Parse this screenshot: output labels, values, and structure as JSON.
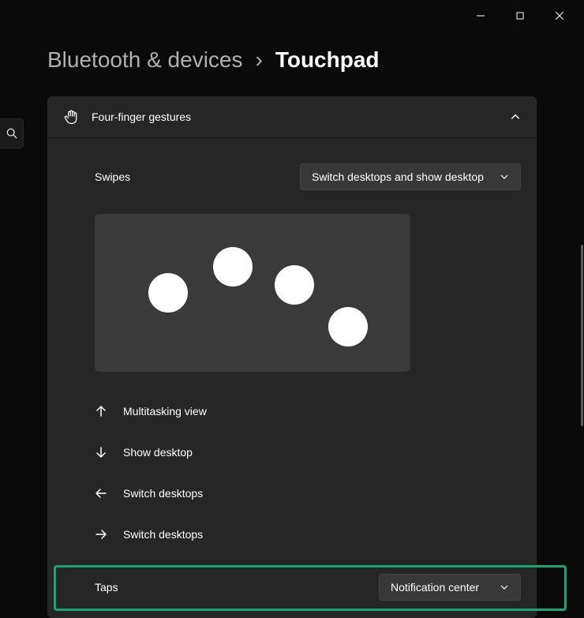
{
  "breadcrumb": {
    "parent": "Bluetooth & devices",
    "separator": "›",
    "current": "Touchpad"
  },
  "panel": {
    "title": "Four-finger gestures",
    "swipes_label": "Swipes",
    "swipes_value": "Switch desktops and show desktop",
    "taps_label": "Taps",
    "taps_value": "Notification center",
    "swipe_actions": [
      {
        "direction": "up",
        "label": "Multitasking view"
      },
      {
        "direction": "down",
        "label": "Show desktop"
      },
      {
        "direction": "left",
        "label": "Switch desktops"
      },
      {
        "direction": "right",
        "label": "Switch desktops"
      }
    ]
  }
}
